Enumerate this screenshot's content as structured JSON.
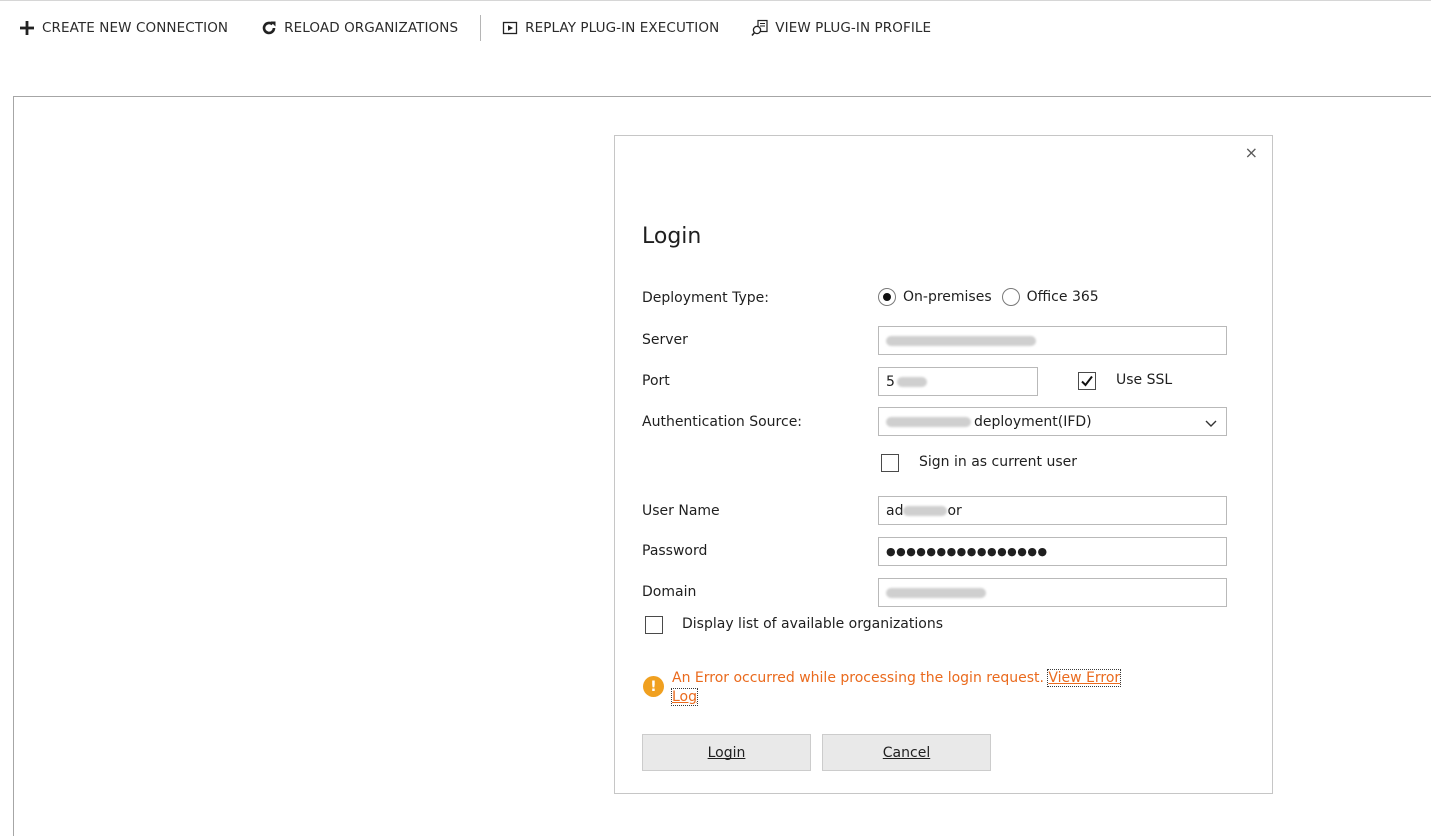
{
  "toolbar": {
    "create_label": "CREATE NEW CONNECTION",
    "reload_label": "RELOAD ORGANIZATIONS",
    "replay_label": "REPLAY PLUG-IN EXECUTION",
    "profile_label": "VIEW PLUG-IN PROFILE"
  },
  "dialog": {
    "close_glyph": "×",
    "title": "Login",
    "deployment_type_label": "Deployment Type:",
    "deployment_options": [
      "On-premises",
      "Office 365"
    ],
    "deployment_selected": "On-premises",
    "server_label": "Server",
    "port_label": "Port",
    "port_value_visible": "5",
    "use_ssl_label": "Use SSL",
    "use_ssl_checked": true,
    "auth_source_label": "Authentication Source:",
    "auth_source_value_visible": "deployment(IFD)",
    "sign_in_current_label": "Sign in as current user",
    "sign_in_current_checked": false,
    "username_label": "User Name",
    "username_visible_start": "ad",
    "username_visible_end": "or",
    "password_label": "Password",
    "password_mask": "●●●●●●●●●●●●●●●●",
    "domain_label": "Domain",
    "display_orgs_label": "Display list of available organizations",
    "display_orgs_checked": false,
    "error_message": "An Error occurred while processing the login request.",
    "error_link_part1": "View Error",
    "error_link_part2": "Log",
    "login_button_label": "Login",
    "cancel_button_label": "Cancel"
  },
  "colors": {
    "error_text": "#ea6a1d",
    "warning_icon": "#f0a020",
    "button_bg": "#e9e9e9"
  }
}
